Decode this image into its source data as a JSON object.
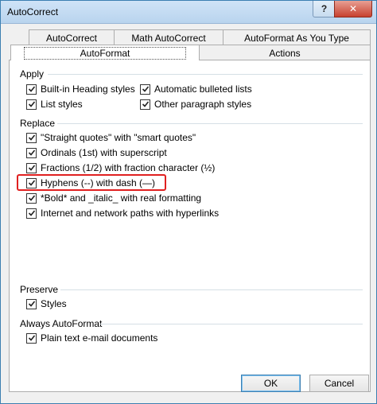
{
  "window": {
    "title": "AutoCorrect",
    "help_symbol": "?",
    "close_symbol": "✕"
  },
  "tabs": {
    "row1": [
      {
        "label": "AutoCorrect"
      },
      {
        "label": "Math AutoCorrect"
      },
      {
        "label": "AutoFormat As You Type"
      }
    ],
    "row2": [
      {
        "label": "AutoFormat",
        "active": true
      },
      {
        "label": "Actions"
      }
    ]
  },
  "apply": {
    "heading": "Apply",
    "items": [
      {
        "label": "Built-in Heading styles",
        "checked": true
      },
      {
        "label": "List styles",
        "checked": true
      },
      {
        "label": "Automatic bulleted lists",
        "checked": true
      },
      {
        "label": "Other paragraph styles",
        "checked": true
      }
    ]
  },
  "replace": {
    "heading": "Replace",
    "items": [
      {
        "label": "\"Straight quotes\" with \"smart quotes\"",
        "checked": true
      },
      {
        "label": "Ordinals (1st) with superscript",
        "checked": true
      },
      {
        "label": "Fractions (1/2) with fraction character (½)",
        "checked": true
      },
      {
        "label": "Hyphens (--) with dash (—)",
        "checked": true
      },
      {
        "label": "*Bold* and _italic_ with real formatting",
        "checked": true
      },
      {
        "label": "Internet and network paths with hyperlinks",
        "checked": true
      }
    ]
  },
  "preserve": {
    "heading": "Preserve",
    "items": [
      {
        "label": "Styles",
        "checked": true
      }
    ]
  },
  "always": {
    "heading": "Always AutoFormat",
    "items": [
      {
        "label": "Plain text e-mail documents",
        "checked": true
      }
    ]
  },
  "buttons": {
    "ok": "OK",
    "cancel": "Cancel"
  },
  "colors": {
    "highlight": "#e02020",
    "close": "#c7412f"
  }
}
